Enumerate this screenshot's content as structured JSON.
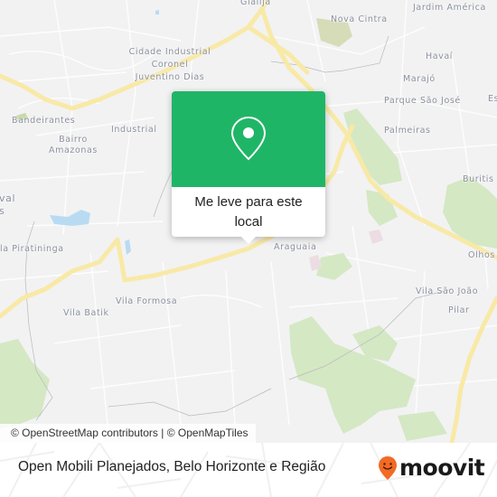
{
  "map": {
    "colors": {
      "land": "#f2f2f3",
      "road_major": "#f8e9a6",
      "road_minor": "#ffffff",
      "park": "#d4e8c4",
      "water": "#b9dbf2",
      "label": "#8a8f9c"
    },
    "place_labels": [
      {
        "name": "Glalijá"
      },
      {
        "name": "Nova Cintra"
      },
      {
        "name": "Jardim América"
      },
      {
        "name": "Cidade Industrial"
      },
      {
        "name": "Coronel"
      },
      {
        "name": "Juventino Dias"
      },
      {
        "name": "Havaí"
      },
      {
        "name": "Marajó"
      },
      {
        "name": "Parque São José"
      },
      {
        "name": "Es"
      },
      {
        "name": "Bandeirantes"
      },
      {
        "name": "Industrial"
      },
      {
        "name": "Palmeiras"
      },
      {
        "name": "Bairro"
      },
      {
        "name": "Amazonas"
      },
      {
        "name": "Buritis"
      },
      {
        "name": "val"
      },
      {
        "name": "s"
      },
      {
        "name": "Araguaia"
      },
      {
        "name": "la Piratininga"
      },
      {
        "name": "Olhos"
      },
      {
        "name": "Vila Formosa"
      },
      {
        "name": "Vila São João"
      },
      {
        "name": "Vila Batik"
      },
      {
        "name": "Pilar"
      }
    ]
  },
  "popup": {
    "icon": "map-pin-icon",
    "action_label": "Me leve para este local",
    "accent": "#1fb567"
  },
  "attribution": {
    "osm": "© OpenStreetMap contributors",
    "separator": "|",
    "tiles": "© OpenMapTiles"
  },
  "footer": {
    "title": "Open Mobili Planejados, Belo Horizonte e Região",
    "brand": {
      "name": "moovit",
      "icon": "moovit-smiley-pin-icon",
      "color": "#f26a23"
    }
  }
}
